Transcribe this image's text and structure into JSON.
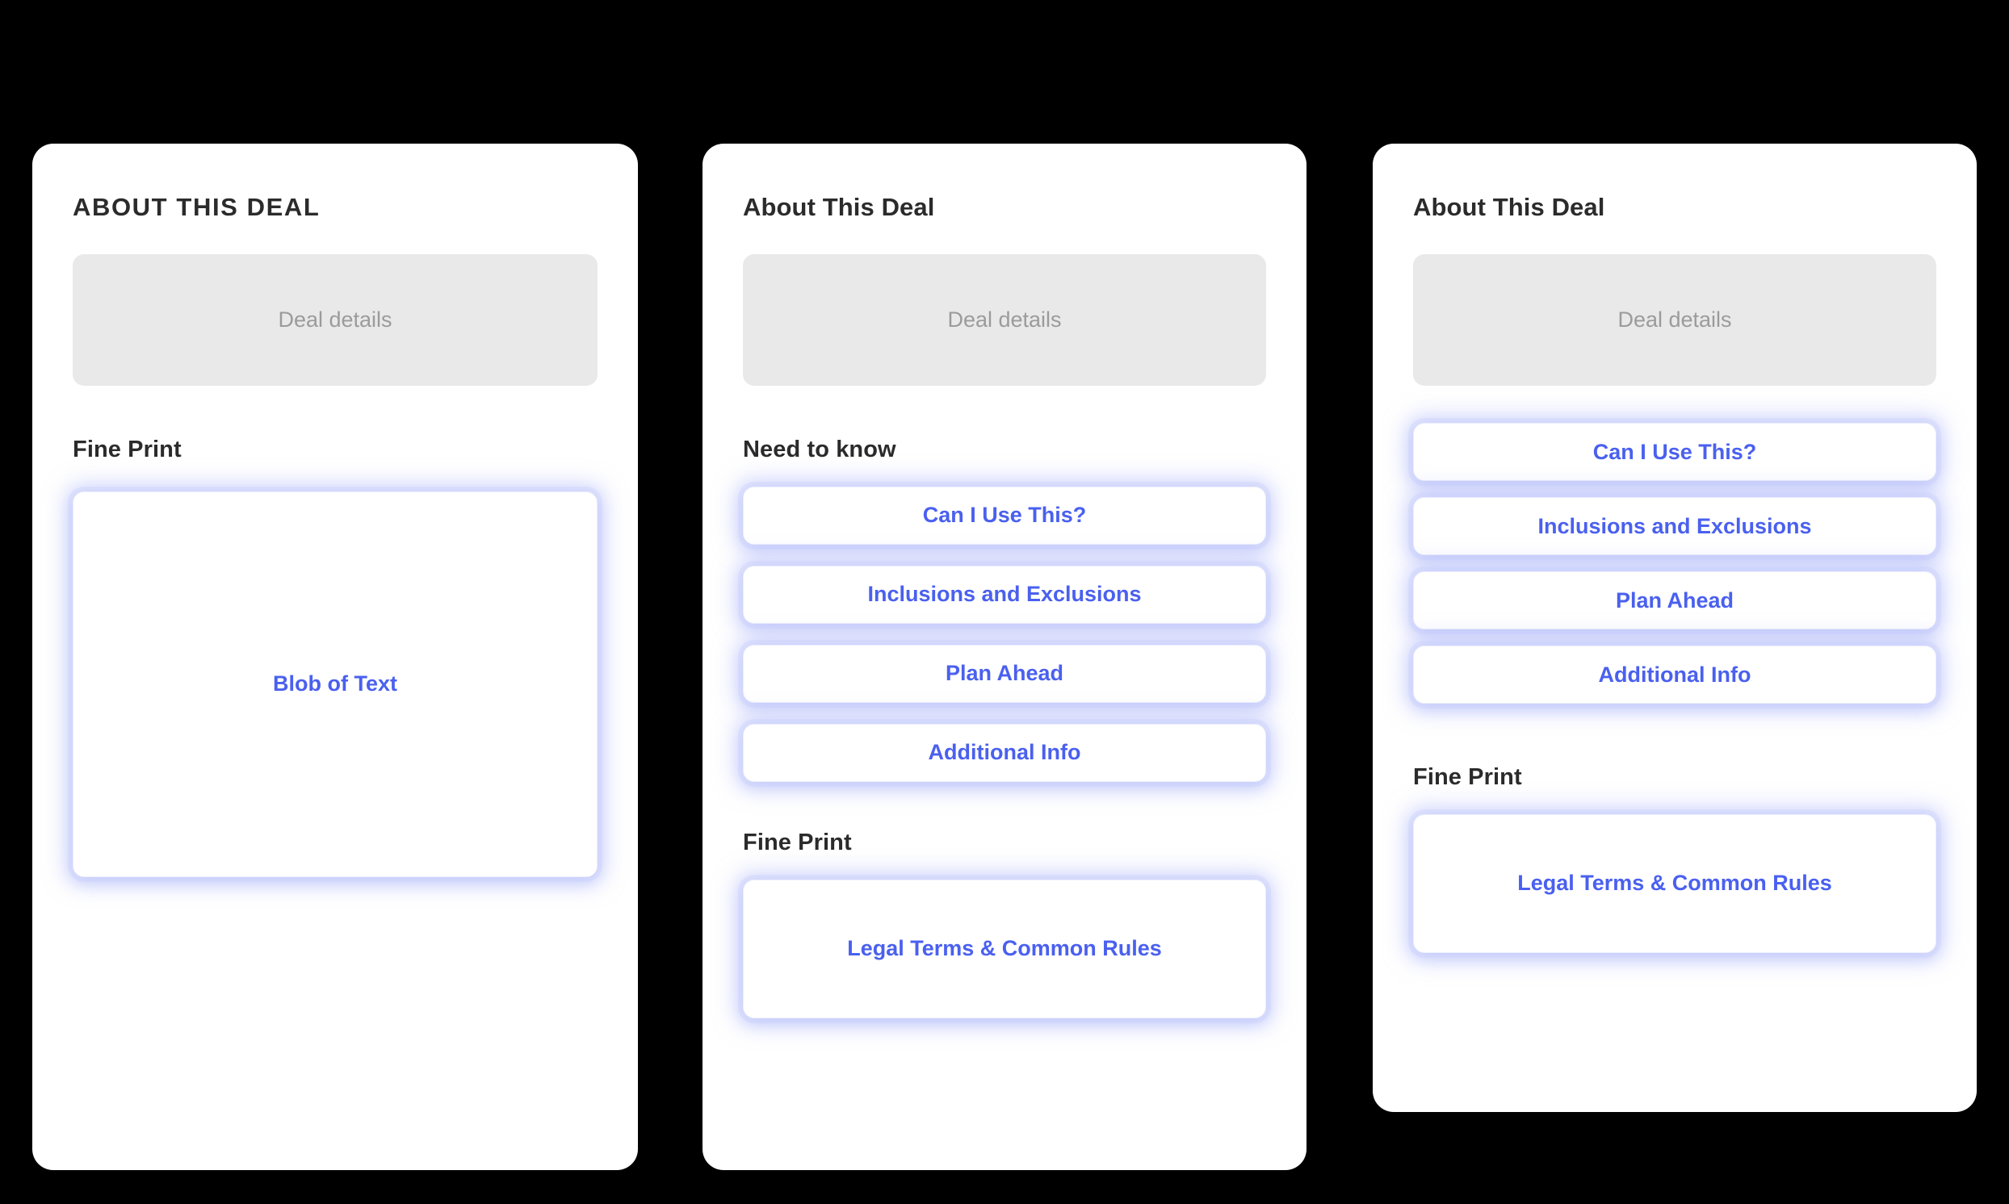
{
  "background_color": "#000000",
  "accent_color": "#4a60ef",
  "card_color": "#ffffff",
  "placeholder_bg_color": "#e9e9e9",
  "placeholder_text_color": "#9b9b9b",
  "heading_color": "#2b2b2b",
  "variants": [
    {
      "id": "variant-1",
      "about_heading": "ABOUT THIS DEAL",
      "deal_details_placeholder": "Deal details",
      "fine_print_heading": "Fine Print",
      "fine_print_button": "Blob of Text",
      "need_to_know_heading": null,
      "need_to_know_buttons": []
    },
    {
      "id": "variant-2",
      "about_heading": "About This Deal",
      "deal_details_placeholder": "Deal details",
      "need_to_know_heading": "Need to know",
      "need_to_know_buttons": [
        "Can I Use This?",
        "Inclusions and Exclusions",
        "Plan Ahead",
        "Additional Info"
      ],
      "fine_print_heading": "Fine Print",
      "fine_print_button": "Legal Terms & Common Rules"
    },
    {
      "id": "variant-3",
      "about_heading": "About This Deal",
      "deal_details_placeholder": "Deal details",
      "need_to_know_heading": null,
      "need_to_know_buttons": [
        "Can I Use This?",
        "Inclusions and Exclusions",
        "Plan Ahead",
        "Additional Info"
      ],
      "fine_print_heading": "Fine Print",
      "fine_print_button": "Legal Terms & Common Rules"
    }
  ]
}
